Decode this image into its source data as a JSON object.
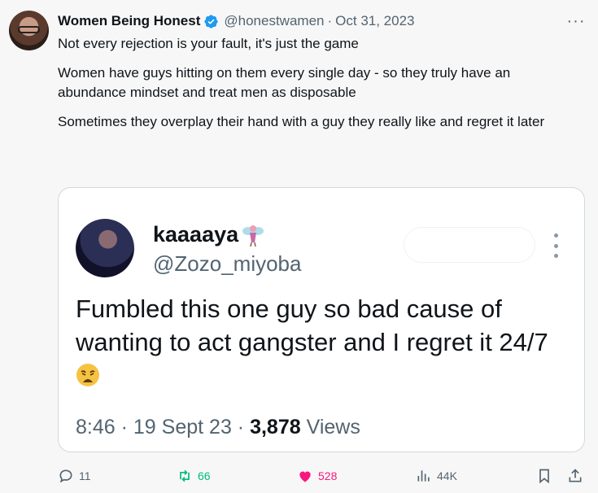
{
  "author": {
    "name": "Women Being Honest",
    "handle": "@honestwamen",
    "separator": "·",
    "date": "Oct 31, 2023"
  },
  "tweet": {
    "paragraphs": [
      "Not every rejection is your fault, it's just the game",
      "Women have guys hitting on them every single day - so they truly have an abundance mindset and treat men as disposable",
      "Sometimes they overplay their hand with a guy they really like and regret it later"
    ]
  },
  "embedded": {
    "name": "kaaaaya",
    "handle": "@Zozo_miyoba",
    "text": "Fumbled this one guy so bad cause of wanting to act gangster and I regret it 24/7",
    "time": "8:46",
    "date": "19 Sept 23",
    "views_count": "3,878",
    "views_label": "Views",
    "meta_separator": "·"
  },
  "actions": {
    "replies": "11",
    "reposts": "66",
    "likes": "528",
    "views": "44K"
  },
  "colors": {
    "accent": "#1d9bf0",
    "repost": "#00ba7c",
    "like": "#f91880",
    "muted": "#536471"
  },
  "icons": [
    "verified-badge-icon",
    "more-icon",
    "fairy-emoji-icon",
    "weary-face-emoji-icon",
    "reply-icon",
    "repost-icon",
    "like-icon",
    "views-icon",
    "bookmark-icon",
    "share-icon"
  ]
}
